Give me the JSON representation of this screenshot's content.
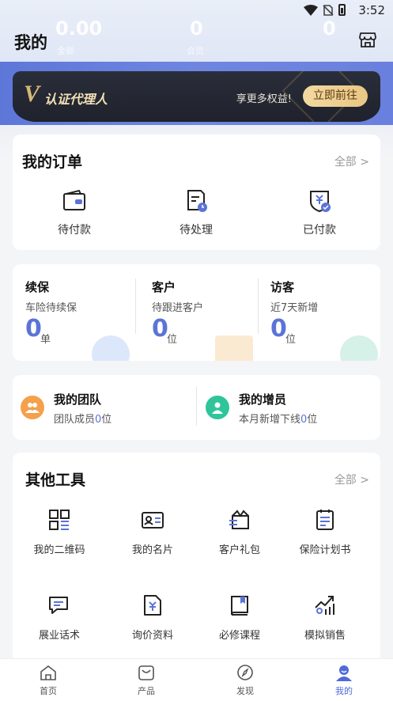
{
  "status_bar": {
    "time": "3:52"
  },
  "header": {
    "title": "我的",
    "ghost_values": [
      "0.00",
      "0",
      "0"
    ],
    "ghost_labels": [
      "金额",
      "会员"
    ]
  },
  "banner": {
    "badge": "V",
    "title": "认证代理人",
    "tip": "享更多权益!",
    "button": "立即前往"
  },
  "orders": {
    "title": "我的订单",
    "all_label": "全部 >",
    "items": [
      {
        "label": "待付款",
        "icon": "wallet-icon"
      },
      {
        "label": "待处理",
        "icon": "pending-document-icon"
      },
      {
        "label": "已付款",
        "icon": "paid-shield-icon"
      }
    ]
  },
  "stats": [
    {
      "title": "续保",
      "subtitle": "车险待续保",
      "value": "0",
      "unit": "单"
    },
    {
      "title": "客户",
      "subtitle": "待跟进客户",
      "value": "0",
      "unit": "位"
    },
    {
      "title": "访客",
      "subtitle": "近7天新增",
      "value": "0",
      "unit": "位"
    }
  ],
  "team": [
    {
      "title": "我的团队",
      "sub_prefix": "团队成员",
      "sub_value": "0",
      "sub_suffix": "位",
      "color": "#f5a04a"
    },
    {
      "title": "我的增员",
      "sub_prefix": "本月新增下线",
      "sub_value": "0",
      "sub_suffix": "位",
      "color": "#2fc59b"
    }
  ],
  "tools": {
    "title": "其他工具",
    "all_label": "全部 >",
    "items": [
      {
        "label": "我的二维码",
        "icon": "qrcode-icon"
      },
      {
        "label": "我的名片",
        "icon": "business-card-icon"
      },
      {
        "label": "客户礼包",
        "icon": "gift-icon"
      },
      {
        "label": "保险计划书",
        "icon": "plan-book-icon"
      },
      {
        "label": "展业话术",
        "icon": "chat-script-icon"
      },
      {
        "label": "询价资料",
        "icon": "price-doc-icon"
      },
      {
        "label": "必修课程",
        "icon": "course-book-icon"
      },
      {
        "label": "模拟销售",
        "icon": "sales-chart-icon"
      }
    ]
  },
  "tabbar": [
    {
      "label": "首页",
      "icon": "home-icon"
    },
    {
      "label": "产品",
      "icon": "product-bag-icon"
    },
    {
      "label": "发现",
      "icon": "compass-icon"
    },
    {
      "label": "我的",
      "icon": "profile-icon",
      "active": true
    }
  ],
  "colors": {
    "accent": "#5b74d6",
    "gold": "#e9c784",
    "dark_banner": "#23262f"
  }
}
